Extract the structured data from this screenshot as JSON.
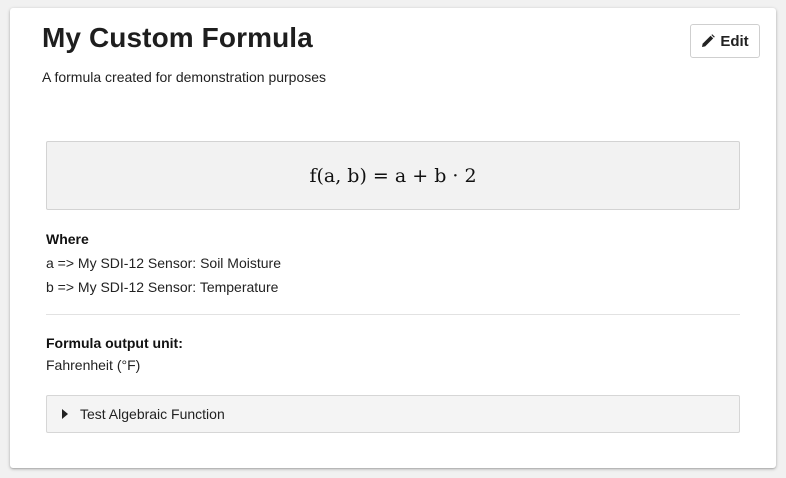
{
  "card": {
    "title": "My Custom Formula",
    "description": "A formula created for demonstration purposes",
    "edit_label": "Edit",
    "edit_icon": "pencil-icon"
  },
  "formula": {
    "expression": "f(a, b) = a + b · 2"
  },
  "where": {
    "heading": "Where",
    "variables": [
      "a => My SDI-12 Sensor: Soil Moisture",
      "b => My SDI-12 Sensor: Temperature"
    ]
  },
  "output_unit": {
    "heading": "Formula output unit:",
    "value": "Fahrenheit (°F)"
  },
  "test_section": {
    "label": "Test Algebraic Function",
    "icon": "caret-right-icon"
  }
}
